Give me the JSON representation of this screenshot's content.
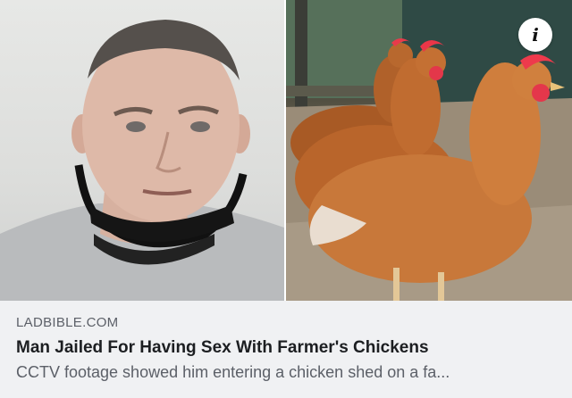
{
  "link_preview": {
    "source": "LADBIBLE.COM",
    "headline": "Man Jailed For Having Sex With Farmer's Chickens",
    "subtitle": "CCTV footage showed him entering a chicken shed on a fa..."
  },
  "info_button": {
    "icon": "info-icon",
    "glyph": "i"
  },
  "colors": {
    "card_background": "#f0f1f3",
    "headline_text": "#1c1e21",
    "secondary_text": "#5c6068"
  }
}
